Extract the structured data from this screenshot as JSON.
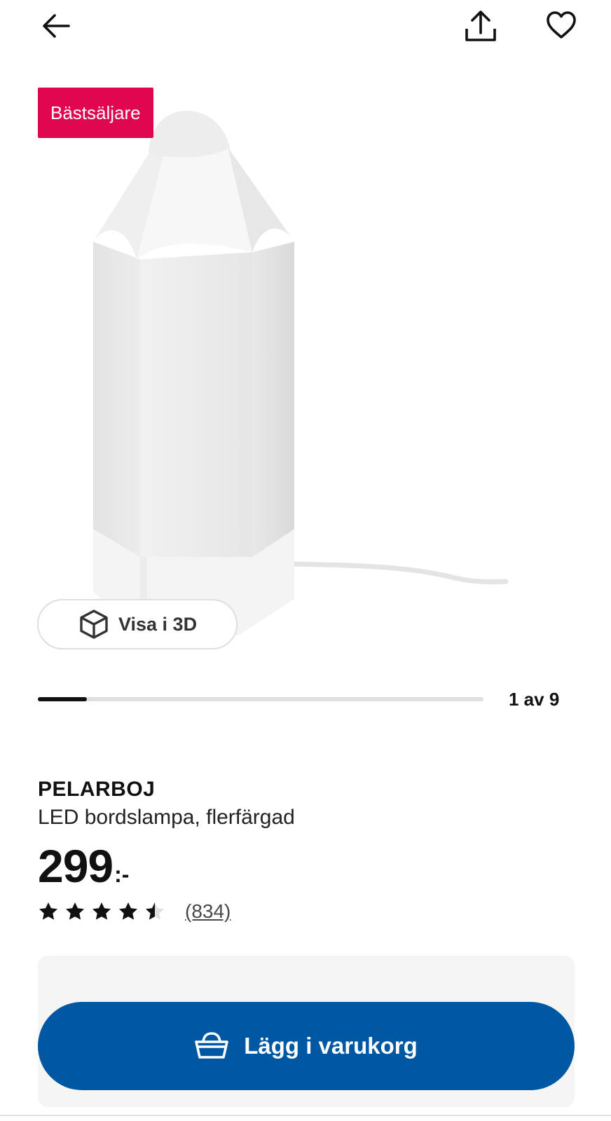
{
  "topbar": {
    "back_icon": "arrow-left-icon",
    "share_icon": "share-icon",
    "wishlist_icon": "heart-icon"
  },
  "gallery": {
    "badge": "Bästsäljare",
    "view3d_label": "Visa i 3D",
    "view3d_icon": "cube-icon",
    "counter": "1 av 9",
    "progress_fraction": 0.11
  },
  "product": {
    "name": "PELARBOJ",
    "description": "LED bordslampa, flerfärgad",
    "price_integer": "299",
    "price_suffix": ":-",
    "rating_value": 4.5,
    "rating_max": 5,
    "review_count": "(834)"
  },
  "cart": {
    "button_label": "Lägg i varukorg",
    "button_icon": "basket-icon"
  },
  "colors": {
    "badge": "#e00751",
    "primary": "#0058a3",
    "panel": "#f5f5f5"
  }
}
